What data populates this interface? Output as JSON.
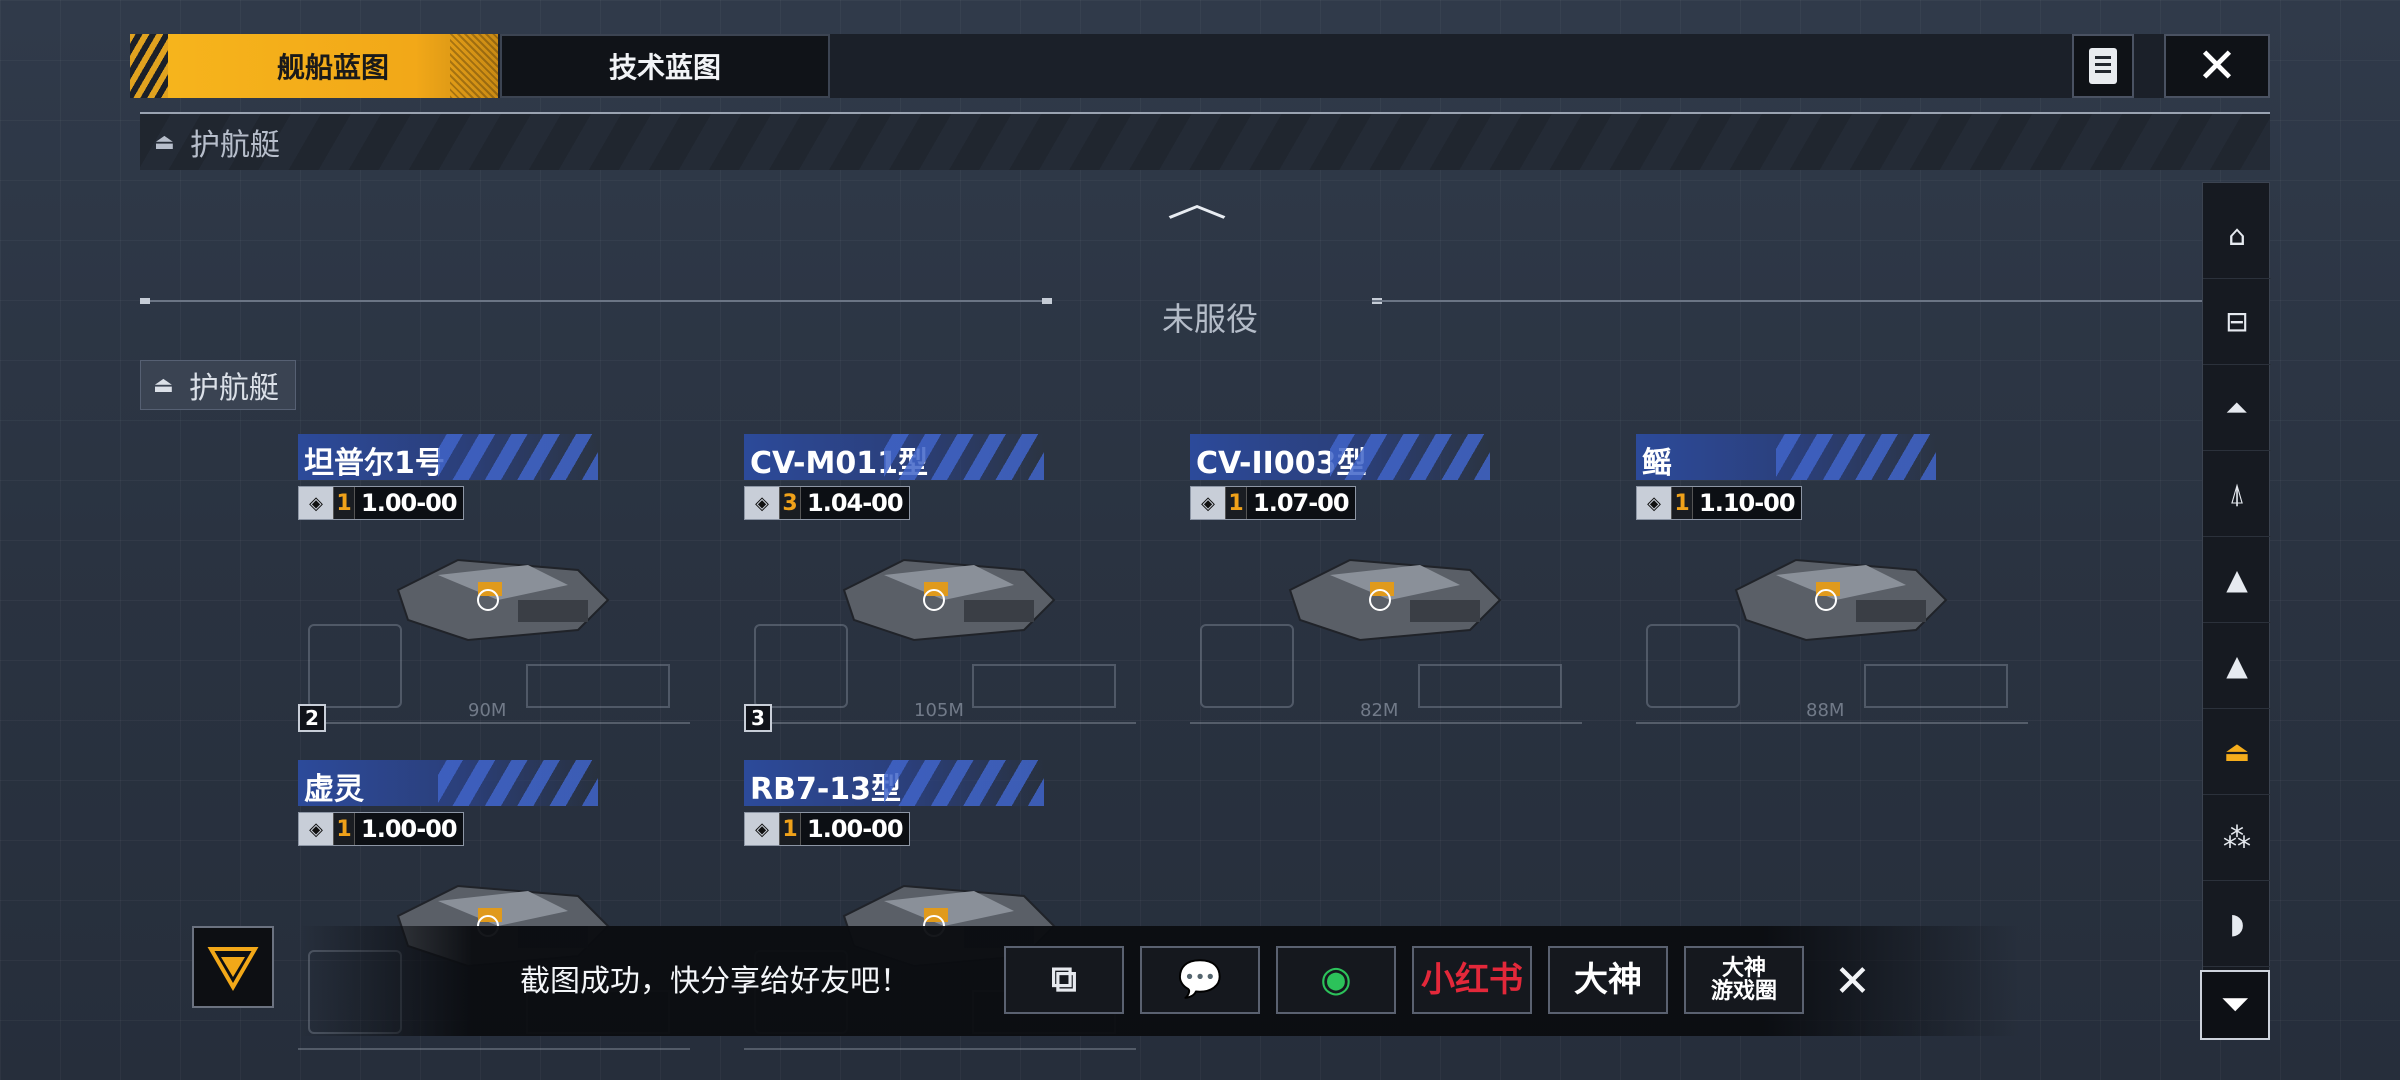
{
  "tabs": [
    {
      "label": "舰船蓝图",
      "active": true
    },
    {
      "label": "技术蓝图",
      "active": false
    }
  ],
  "header": {
    "icons": [
      "document-icon",
      "close-icon"
    ],
    "close_glyph": "✕"
  },
  "section": {
    "title": "护航艇",
    "collapse_glyph": "︿"
  },
  "status_divider": "未服役",
  "category_tag": "护航艇",
  "ships": [
    {
      "name": "坦普尔1号",
      "stat_num": "1",
      "stat_value": "1.00",
      "stat_suffix": "-00",
      "qty": "2",
      "length": "90M",
      "faction_icon": "emblem-icon"
    },
    {
      "name": "CV-M011型",
      "stat_num": "3",
      "stat_value": "1.04",
      "stat_suffix": "-00",
      "qty": "3",
      "length": "105M",
      "faction_icon": "globe-icon"
    },
    {
      "name": "CV-II003型",
      "stat_num": "1",
      "stat_value": "1.07",
      "stat_suffix": "-00",
      "qty": "",
      "length": "82M",
      "faction_icon": "globe-icon"
    },
    {
      "name": "鳐",
      "stat_num": "1",
      "stat_value": "1.10",
      "stat_suffix": "-00",
      "qty": "",
      "length": "88M",
      "faction_icon": "wing-icon"
    },
    {
      "name": "虚灵",
      "stat_num": "1",
      "stat_value": "1.00",
      "stat_suffix": "-00",
      "qty": "",
      "length": "",
      "faction_icon": "ship-icon"
    },
    {
      "name": "RB7-13型",
      "stat_num": "1",
      "stat_value": "1.00",
      "stat_suffix": "-00",
      "qty": "",
      "length": "",
      "faction_icon": "wing-icon"
    }
  ],
  "sidebar_items": [
    "carrier-icon",
    "battleship-icon",
    "cruiser-icon",
    "destroyer-icon",
    "frigate-icon",
    "corvette-icon",
    "escort-icon",
    "fighter-icon",
    "misc-icon"
  ],
  "sidebar_selected": 6,
  "toast": {
    "message": "截图成功，快分享给好友吧！",
    "share_targets": [
      {
        "name": "screen-share",
        "label": "⧉"
      },
      {
        "name": "wechat",
        "label": "💬"
      },
      {
        "name": "moments",
        "label": "◉"
      },
      {
        "name": "xiaohongshu",
        "label": "小红书"
      },
      {
        "name": "dashen",
        "label": "大神"
      },
      {
        "name": "dashen-circle",
        "label": "大神\n游戏圈"
      }
    ],
    "close_glyph": "✕"
  },
  "colors": {
    "accent": "#f2a818",
    "name_bar": "#2c4a9a",
    "bg": "#2a3341"
  }
}
